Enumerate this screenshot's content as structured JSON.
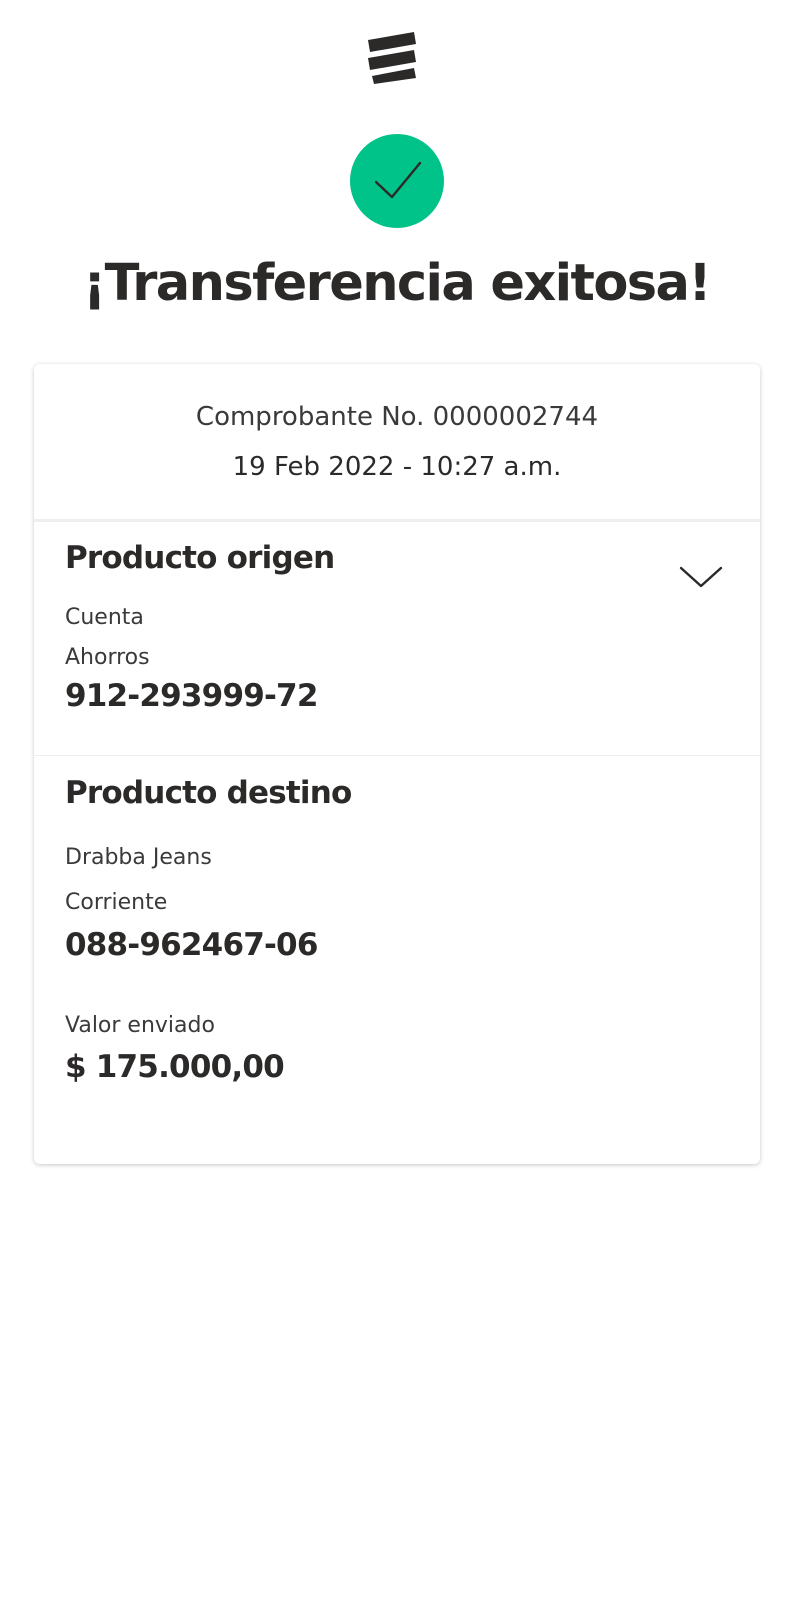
{
  "header": {
    "logo_icon": "bancolombia-logo-icon",
    "success_icon": "checkmark-icon",
    "success_color": "#00c389",
    "title": "¡Transferencia exitosa!"
  },
  "receipt": {
    "number_text": "Comprobante No. 0000002744",
    "datetime_text": "19 Feb 2022 - 10:27 a.m."
  },
  "origin": {
    "title": "Producto origen",
    "expand_icon": "chevron-down-icon",
    "type_label": "Cuenta",
    "account_kind": "Ahorros",
    "account_number": "912-293999-72"
  },
  "destination": {
    "title": "Producto destino",
    "holder_name": "Drabba Jeans",
    "account_kind": "Corriente",
    "account_number": "088-962467-06"
  },
  "amount": {
    "label": "Valor enviado",
    "value": "$ 175.000,00"
  }
}
